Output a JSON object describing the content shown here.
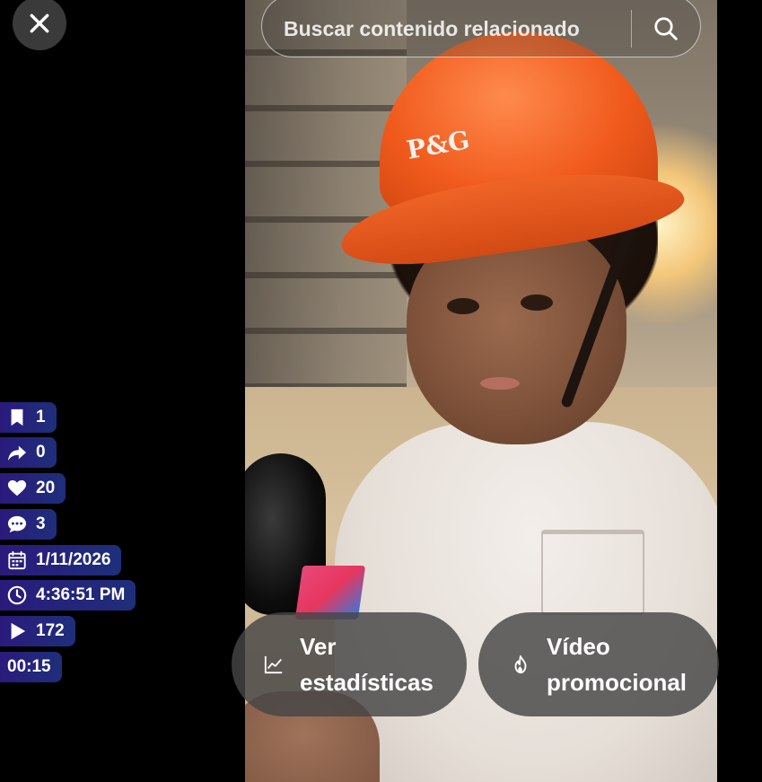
{
  "search": {
    "placeholder": "Buscar contenido relacionado",
    "icon": "search-icon"
  },
  "close": {
    "icon": "close-icon"
  },
  "video": {
    "helmet_text": "P&G"
  },
  "stats": {
    "saves": "1",
    "shares": "0",
    "likes": "20",
    "comments": "3",
    "date": "1/11/2026",
    "time": "4:36:51 PM",
    "views": "172",
    "duration": "00:15"
  },
  "actions": {
    "stats_label": "Ver estadísticas",
    "promo_label": "Vídeo promocional"
  },
  "colors": {
    "badge_start": "#2a1a7c",
    "badge_end": "#1e2f7a",
    "pill_bg": "#464646",
    "close_bg": "#3a3a3a"
  }
}
